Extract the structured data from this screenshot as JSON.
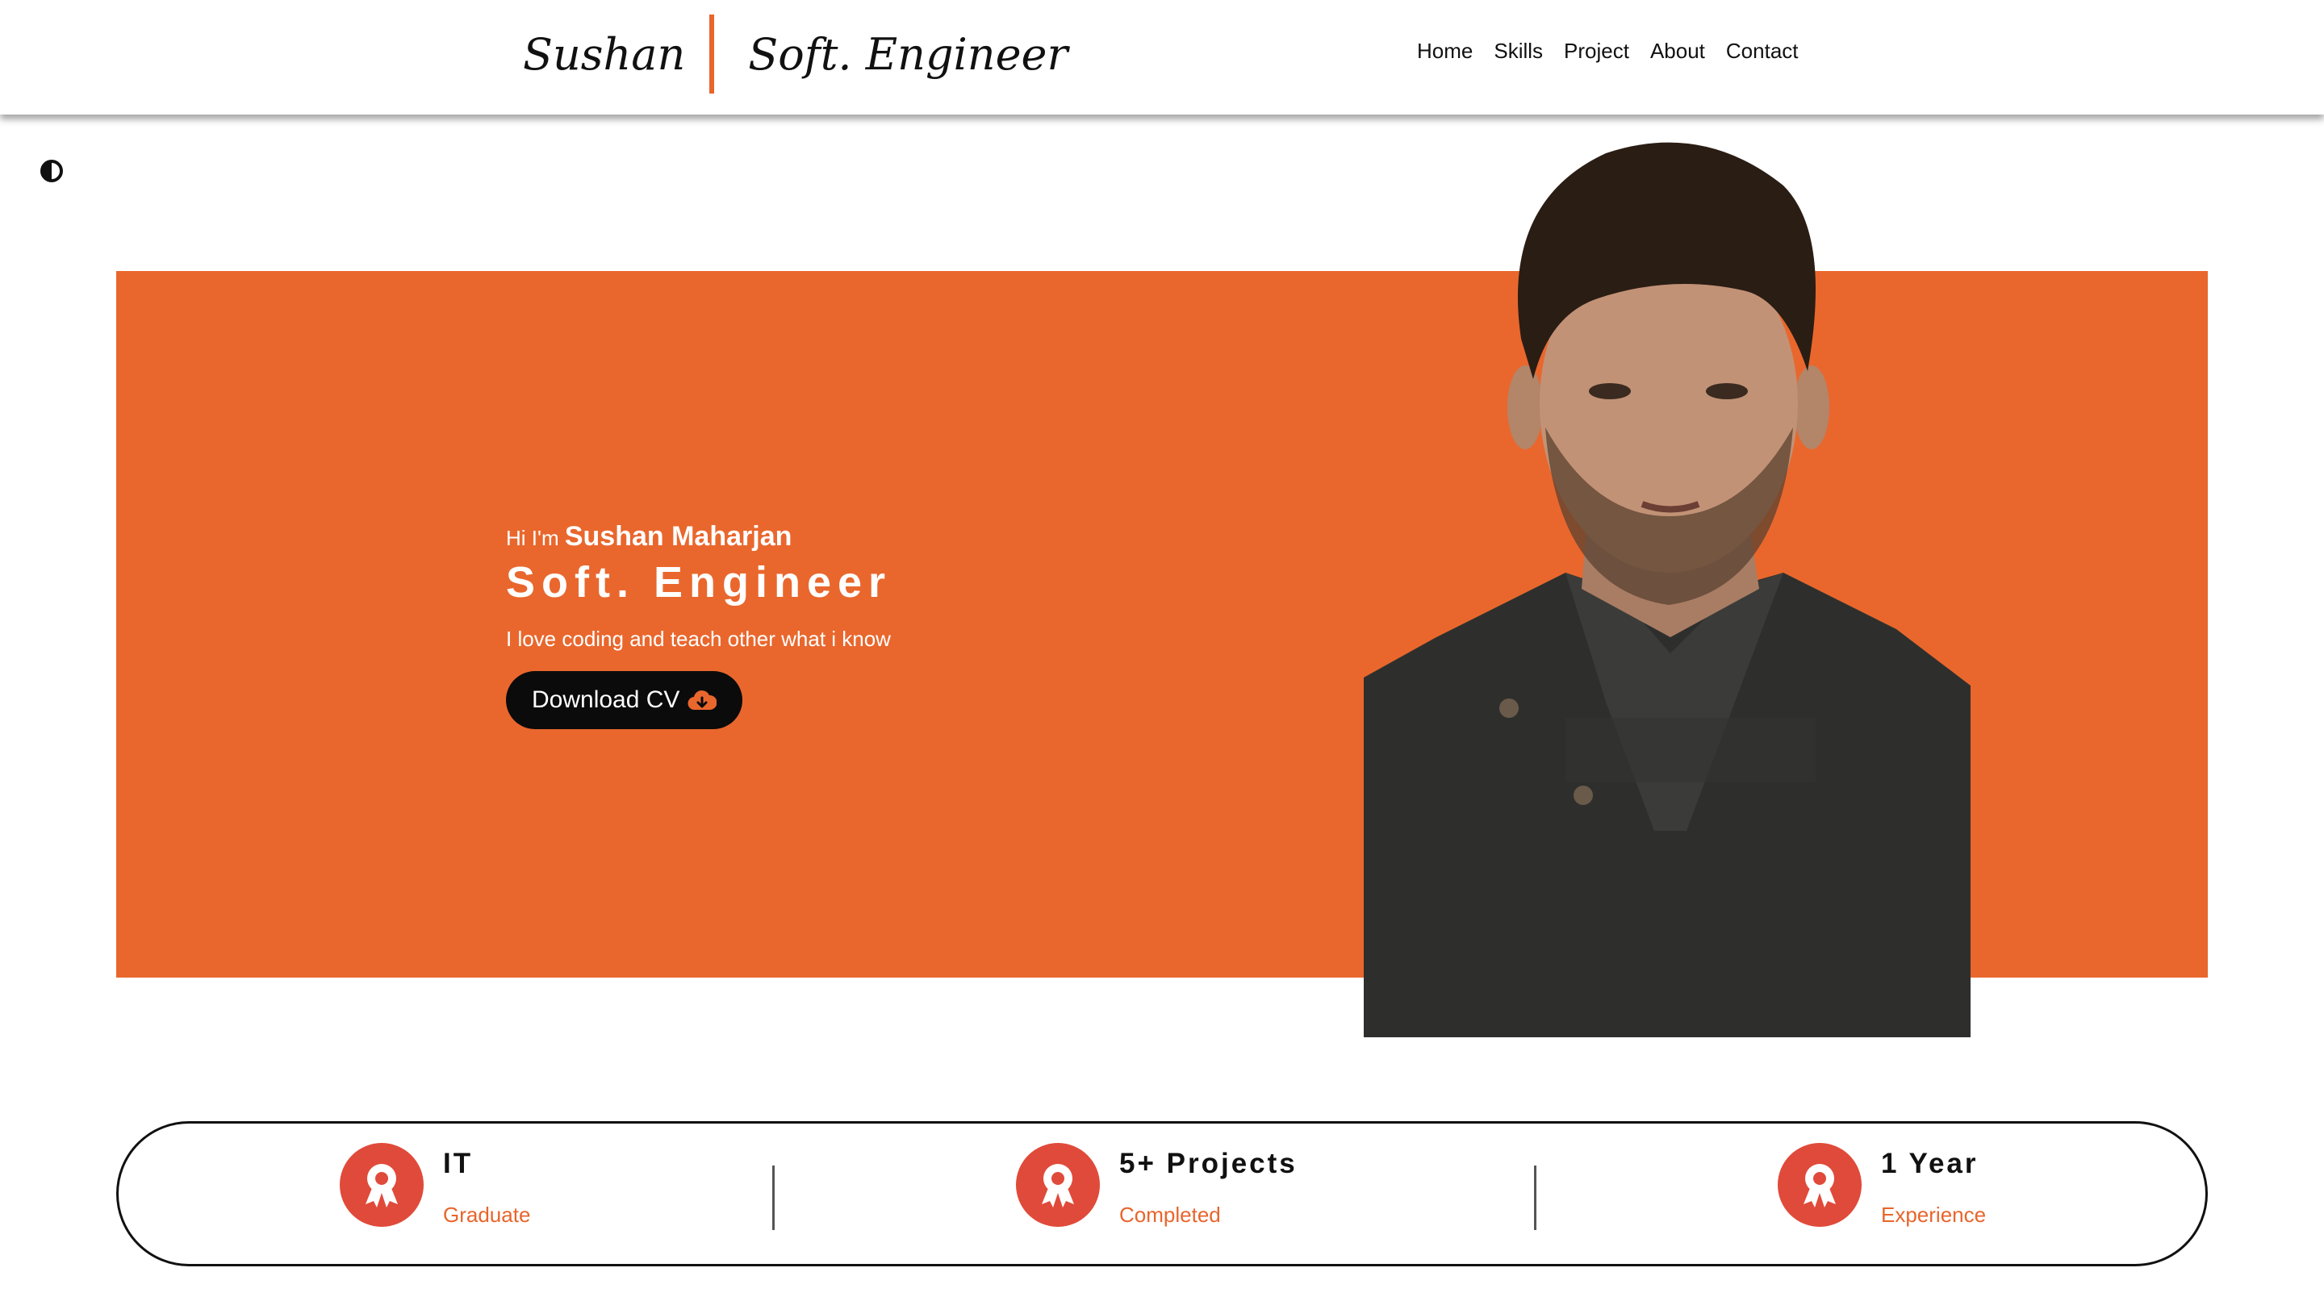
{
  "brand": {
    "name": "Sushan",
    "role": "Soft. Engineer"
  },
  "nav": [
    "Home",
    "Skills",
    "Project",
    "About",
    "Contact"
  ],
  "hero": {
    "greeting": "Hi I'm",
    "name": "Sushan Maharjan",
    "title": "Soft. Engineer",
    "tagline": "I love coding and teach other what i know",
    "cv_button": "Download CV"
  },
  "stats": [
    {
      "main": "IT",
      "sub": "Graduate"
    },
    {
      "main": "5+ Projects",
      "sub": "Completed"
    },
    {
      "main": "1 Year",
      "sub": "Experience"
    }
  ],
  "colors": {
    "accent": "#e9672d",
    "badge": "#e04a3a",
    "button": "#0b0b0b"
  },
  "icons": [
    "theme-toggle-icon",
    "cloud-download-icon",
    "award-icon"
  ]
}
